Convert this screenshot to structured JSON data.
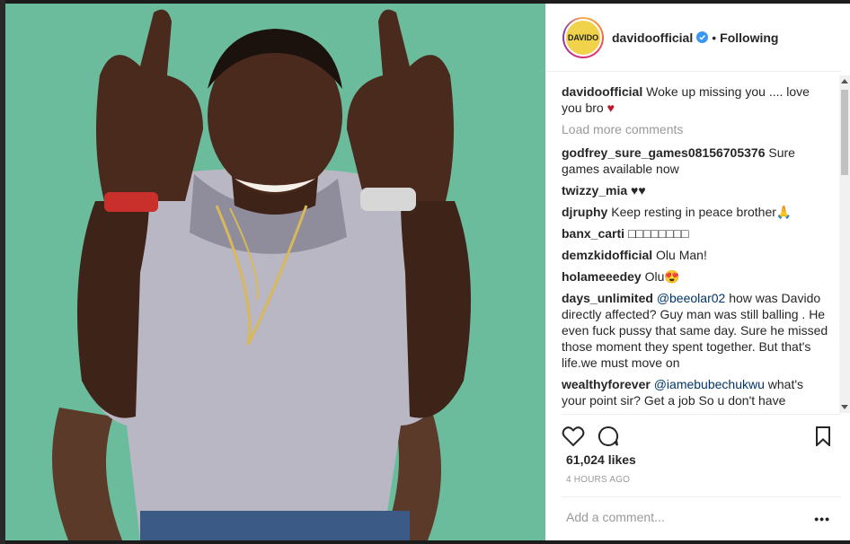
{
  "post": {
    "username": "davidoofficial",
    "follow_status": "Following",
    "separator": "•",
    "avatar_label": "DAVIDO"
  },
  "comments": {
    "caption": {
      "user": "davidoofficial",
      "text": "Woke up missing you .... love you bro ",
      "emoji": "♥"
    },
    "load_more": "Load more comments",
    "items": [
      {
        "user": "godfrey_sure_games08156705376",
        "text": "Sure games available now"
      },
      {
        "user": "twizzy_mia",
        "text": "♥♥"
      },
      {
        "user": "djruphy",
        "text": "Keep resting in peace brother🙏"
      },
      {
        "user": "banx_carti",
        "text": "□□□□□□□□"
      },
      {
        "user": "demzkidofficial",
        "text": "Olu Man!"
      },
      {
        "user": "holameeedey",
        "text": "Olu😍"
      },
      {
        "user": "days_unlimited",
        "mention": "@beeolar02",
        "text": " how was Davido directly affected? Guy man was still balling . He even fuck pussy that same day. Sure he missed those moment they spent together. But that's life.we must move on"
      },
      {
        "user": "wealthyforever",
        "mention": "@iamebubechukwu",
        "text": " what's your point sir? Get a job So u don't have"
      }
    ]
  },
  "footer": {
    "likes": "61,024 likes",
    "time": "4 HOURS AGO",
    "add_comment_placeholder": "Add a comment...",
    "options": "•••"
  },
  "icons": {
    "like": "heart-icon",
    "comment": "comment-icon",
    "save": "bookmark-icon",
    "verified": "verified-badge-icon"
  },
  "colors": {
    "photo_background": "#6bbc9c",
    "verified": "#3897f0",
    "mention": "#003569",
    "heart_emoji": "#c0152b"
  }
}
